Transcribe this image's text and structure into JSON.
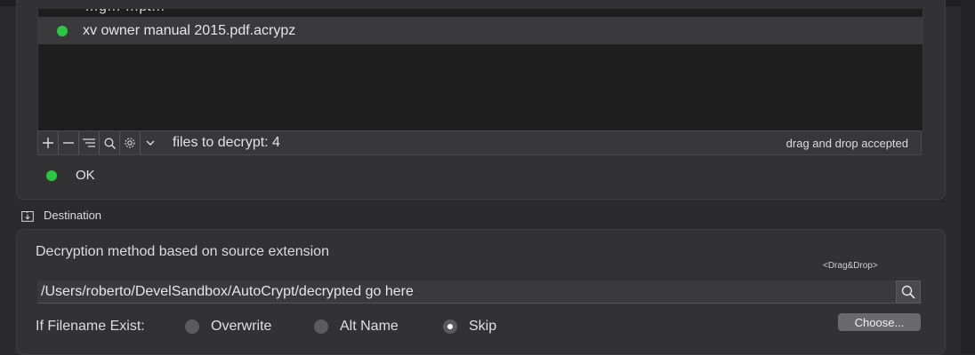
{
  "source": {
    "clipped_row_text": "…g…  …pt…",
    "files": [
      {
        "name": "xv owner manual 2015.pdf.acrypz",
        "status_color": "#28c840",
        "selected": true
      }
    ],
    "toolbar": {
      "add_icon": "plus-icon",
      "remove_icon": "minus-icon",
      "list_icon": "list-icon",
      "search_icon": "search-icon",
      "gear_icon": "gear-icon",
      "menu_icon": "chevron-down-icon",
      "files_label": "files to decrypt: 4",
      "drag_hint": "drag and drop accepted"
    },
    "status_text": "OK",
    "status_color": "#28c840"
  },
  "destination": {
    "header": "Destination",
    "header_icon": "folder-download-icon",
    "method": "Decryption method based on source extension",
    "drag_hint": "<Drag&Drop>",
    "path": "/Users/roberto/DevelSandbox/AutoCrypt/decrypted go here",
    "search_icon": "search-icon",
    "if_exists_label": "If Filename Exist:",
    "options": [
      {
        "label": "Overwrite",
        "selected": false
      },
      {
        "label": "Alt Name",
        "selected": false
      },
      {
        "label": "Skip",
        "selected": true
      }
    ],
    "choose_label": "Choose..."
  }
}
